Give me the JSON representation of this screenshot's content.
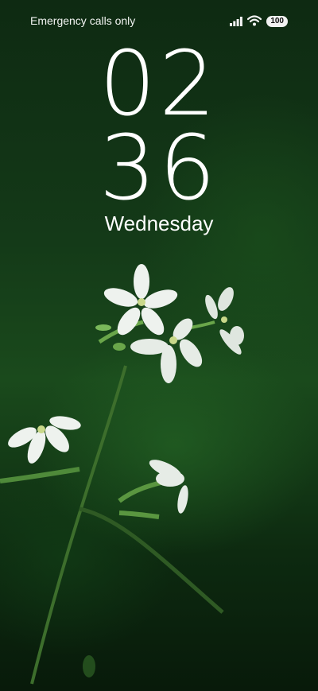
{
  "status_bar": {
    "carrier_text": "Emergency calls only",
    "battery_level": "100",
    "signal_icon": "signal-bars-icon",
    "wifi_icon": "wifi-icon"
  },
  "lock_screen": {
    "hours": "02",
    "minutes": "36",
    "weekday": "Wednesday"
  },
  "wallpaper": {
    "subject": "white-flowers-on-green",
    "colors": {
      "background": "#143a18",
      "petal": "#eef2ee",
      "stem": "#4f8a3a"
    }
  }
}
